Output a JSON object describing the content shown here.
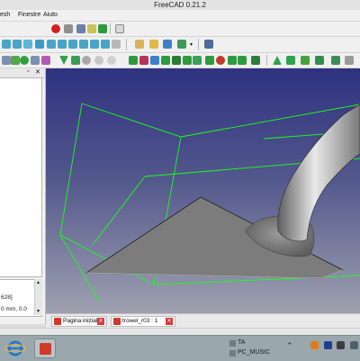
{
  "window": {
    "title": "FreeCAD 0.21.2"
  },
  "menubar": {
    "items": [
      "esh",
      "Finestre",
      "Aiuto"
    ]
  },
  "property_panel": {
    "line1": "628]",
    "line2": "0 mm, 0.0"
  },
  "tabs": [
    {
      "label": "Pagina iniziale",
      "close": "✕"
    },
    {
      "label": "trowel_r03 : 1",
      "close": "✕"
    }
  ],
  "taskbar": {
    "tray_items": [
      "TA",
      "PC_MUSIC"
    ]
  },
  "colors": {
    "viewport_top": "#2f3280",
    "viewport_bottom": "#9fa1b0",
    "bounding_box": "#19ff19",
    "record_button": "#d61f1f",
    "freecad_red": "#cf3a2a"
  },
  "icons": {
    "macro": "record-macro-icon",
    "stop": "stop-macro-icon",
    "whatsthis": "whats-this-icon"
  }
}
